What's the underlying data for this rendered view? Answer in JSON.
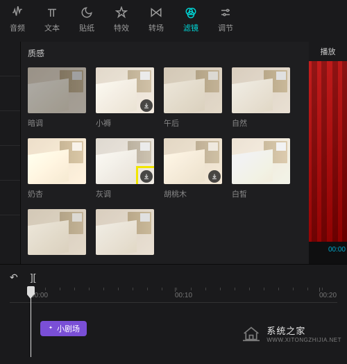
{
  "tabs": [
    {
      "label": "音频",
      "icon": "waveform"
    },
    {
      "label": "文本",
      "icon": "text"
    },
    {
      "label": "贴纸",
      "icon": "moon"
    },
    {
      "label": "特效",
      "icon": "star"
    },
    {
      "label": "转场",
      "icon": "bowtie"
    },
    {
      "label": "滤镜",
      "icon": "venn",
      "active": true
    },
    {
      "label": "调节",
      "icon": "sliders"
    }
  ],
  "section_title": "质感",
  "filters": [
    {
      "name": "暗调",
      "tone": "t1",
      "download": false
    },
    {
      "name": "小褥",
      "tone": "t2",
      "download": true
    },
    {
      "name": "午后",
      "tone": "t3",
      "download": false
    },
    {
      "name": "自然",
      "tone": "t4",
      "download": false
    },
    {
      "name": "奶杏",
      "tone": "t5",
      "download": false
    },
    {
      "name": "灰调",
      "tone": "t6",
      "download": true,
      "highlighted": true
    },
    {
      "name": "胡桃木",
      "tone": "t7",
      "download": true
    },
    {
      "name": "白皙",
      "tone": "t8",
      "download": false
    },
    {
      "name": "",
      "tone": "t3",
      "download": false
    },
    {
      "name": "",
      "tone": "t4",
      "download": false
    }
  ],
  "preview": {
    "header": "播放",
    "time": "00:00"
  },
  "timeline": {
    "ticks": [
      "00:00",
      "00:10",
      "00:20"
    ],
    "clip_label": "小剧场"
  },
  "watermark": {
    "cn": "系统之家",
    "en": "WWW.XITONGZHIJIA.NET"
  }
}
